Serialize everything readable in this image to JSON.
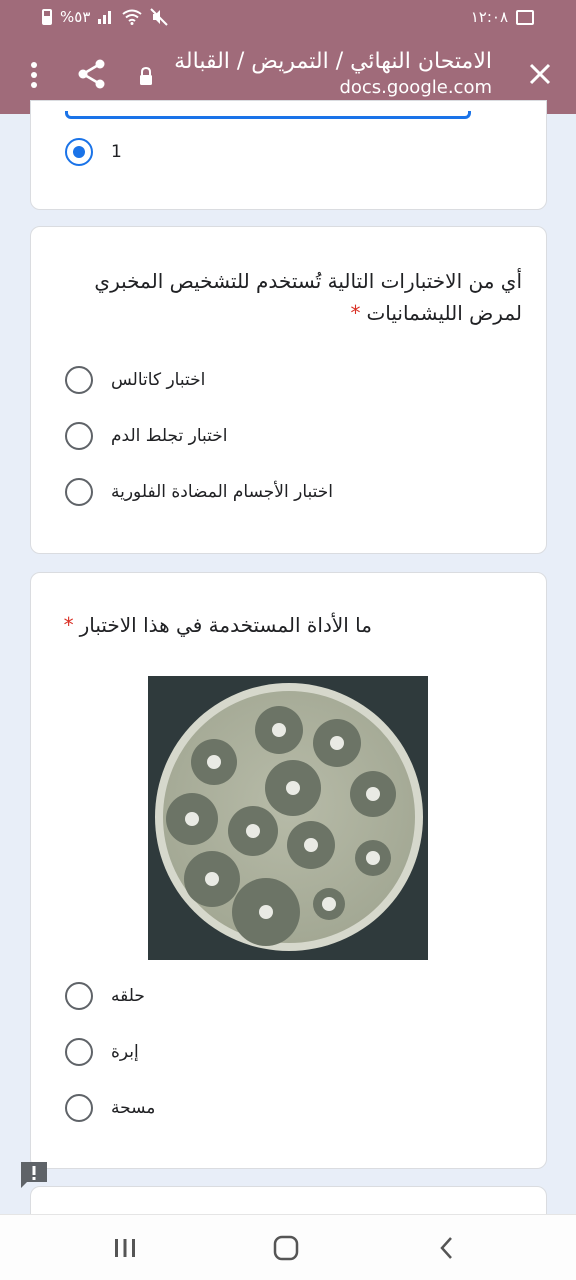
{
  "status_bar": {
    "time": "١٢:٠٨",
    "battery": "%٥٣",
    "battery_level": 0.53
  },
  "app_bar": {
    "title": "الامتحان النهائي / التمريض / القبالة",
    "url": "docs.google.com",
    "icons": [
      "close-icon",
      "lock-icon",
      "share-icon",
      "more-vert-icon"
    ]
  },
  "prev_question": {
    "selected_option": "1"
  },
  "question_leish": {
    "text_line1": "أي من الاختبارات التالية تُستخدم للتشخيص المخبري",
    "text_line2": "لمرض الليشمانيات",
    "required_mark": "*",
    "options": [
      {
        "label": "اختبار كاتالس"
      },
      {
        "label": "اختبار تجلط الدم"
      },
      {
        "label": "اختبار الأجسام المضادة الفلورية"
      }
    ]
  },
  "question_tool": {
    "text": "ما الأداة المستخدمة في هذا الاختبار",
    "required_mark": "*",
    "image": "petri-dish-antibiotic-disks",
    "options": [
      {
        "label": "حلقه"
      },
      {
        "label": "إبرة"
      },
      {
        "label": "مسحة"
      }
    ]
  },
  "colors": {
    "app_bar": "#a06b7a",
    "accent": "#1a73e8",
    "required": "#d93025",
    "page_bg": "#e8eef8"
  }
}
